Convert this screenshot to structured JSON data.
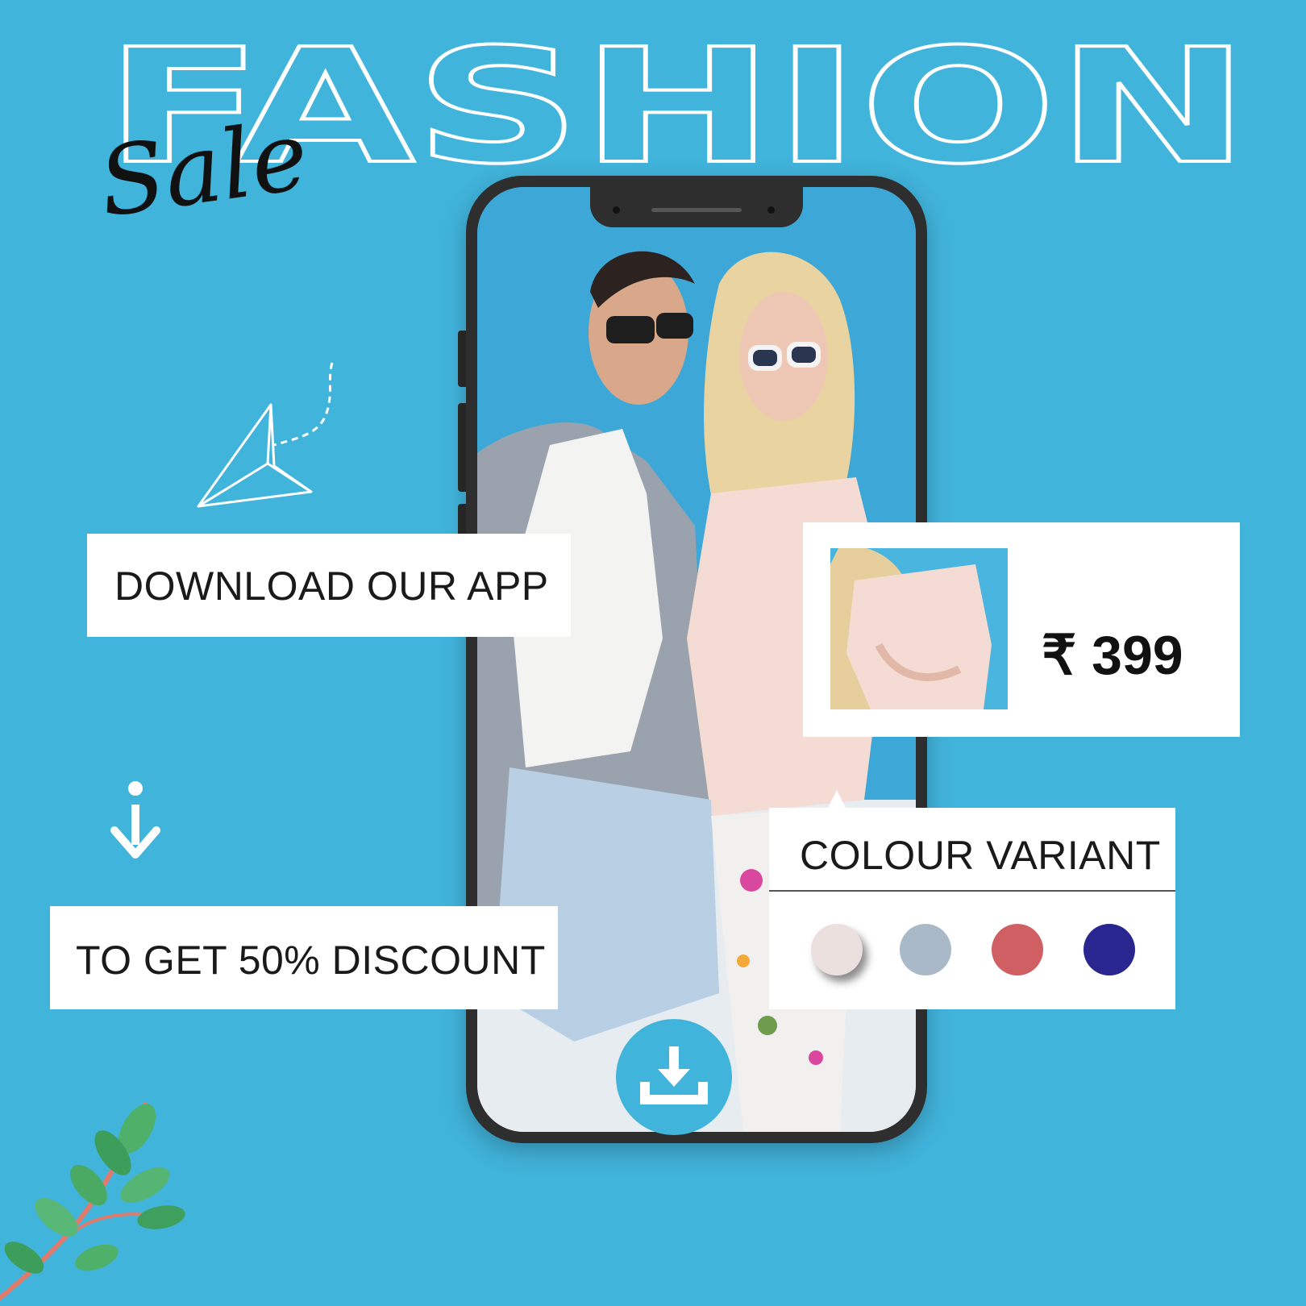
{
  "headline": {
    "title": "FASHION",
    "script_word": "Sale"
  },
  "cta": {
    "download_label": "DOWNLOAD OUR APP",
    "discount_label": "TO GET 50% DISCOUNT"
  },
  "product": {
    "price": "₹ 399"
  },
  "variants": {
    "title": "COLOUR VARIANT",
    "colors": [
      "#ece0de",
      "#a9b9c8",
      "#cf5f63",
      "#2a2690"
    ]
  },
  "colors": {
    "background": "#41b4dc",
    "card": "#ffffff",
    "phone_frame": "#2e2e2e"
  },
  "icons": [
    "paper-plane-icon",
    "info-down-arrow-icon",
    "download-icon",
    "leaf-branch-icon"
  ]
}
